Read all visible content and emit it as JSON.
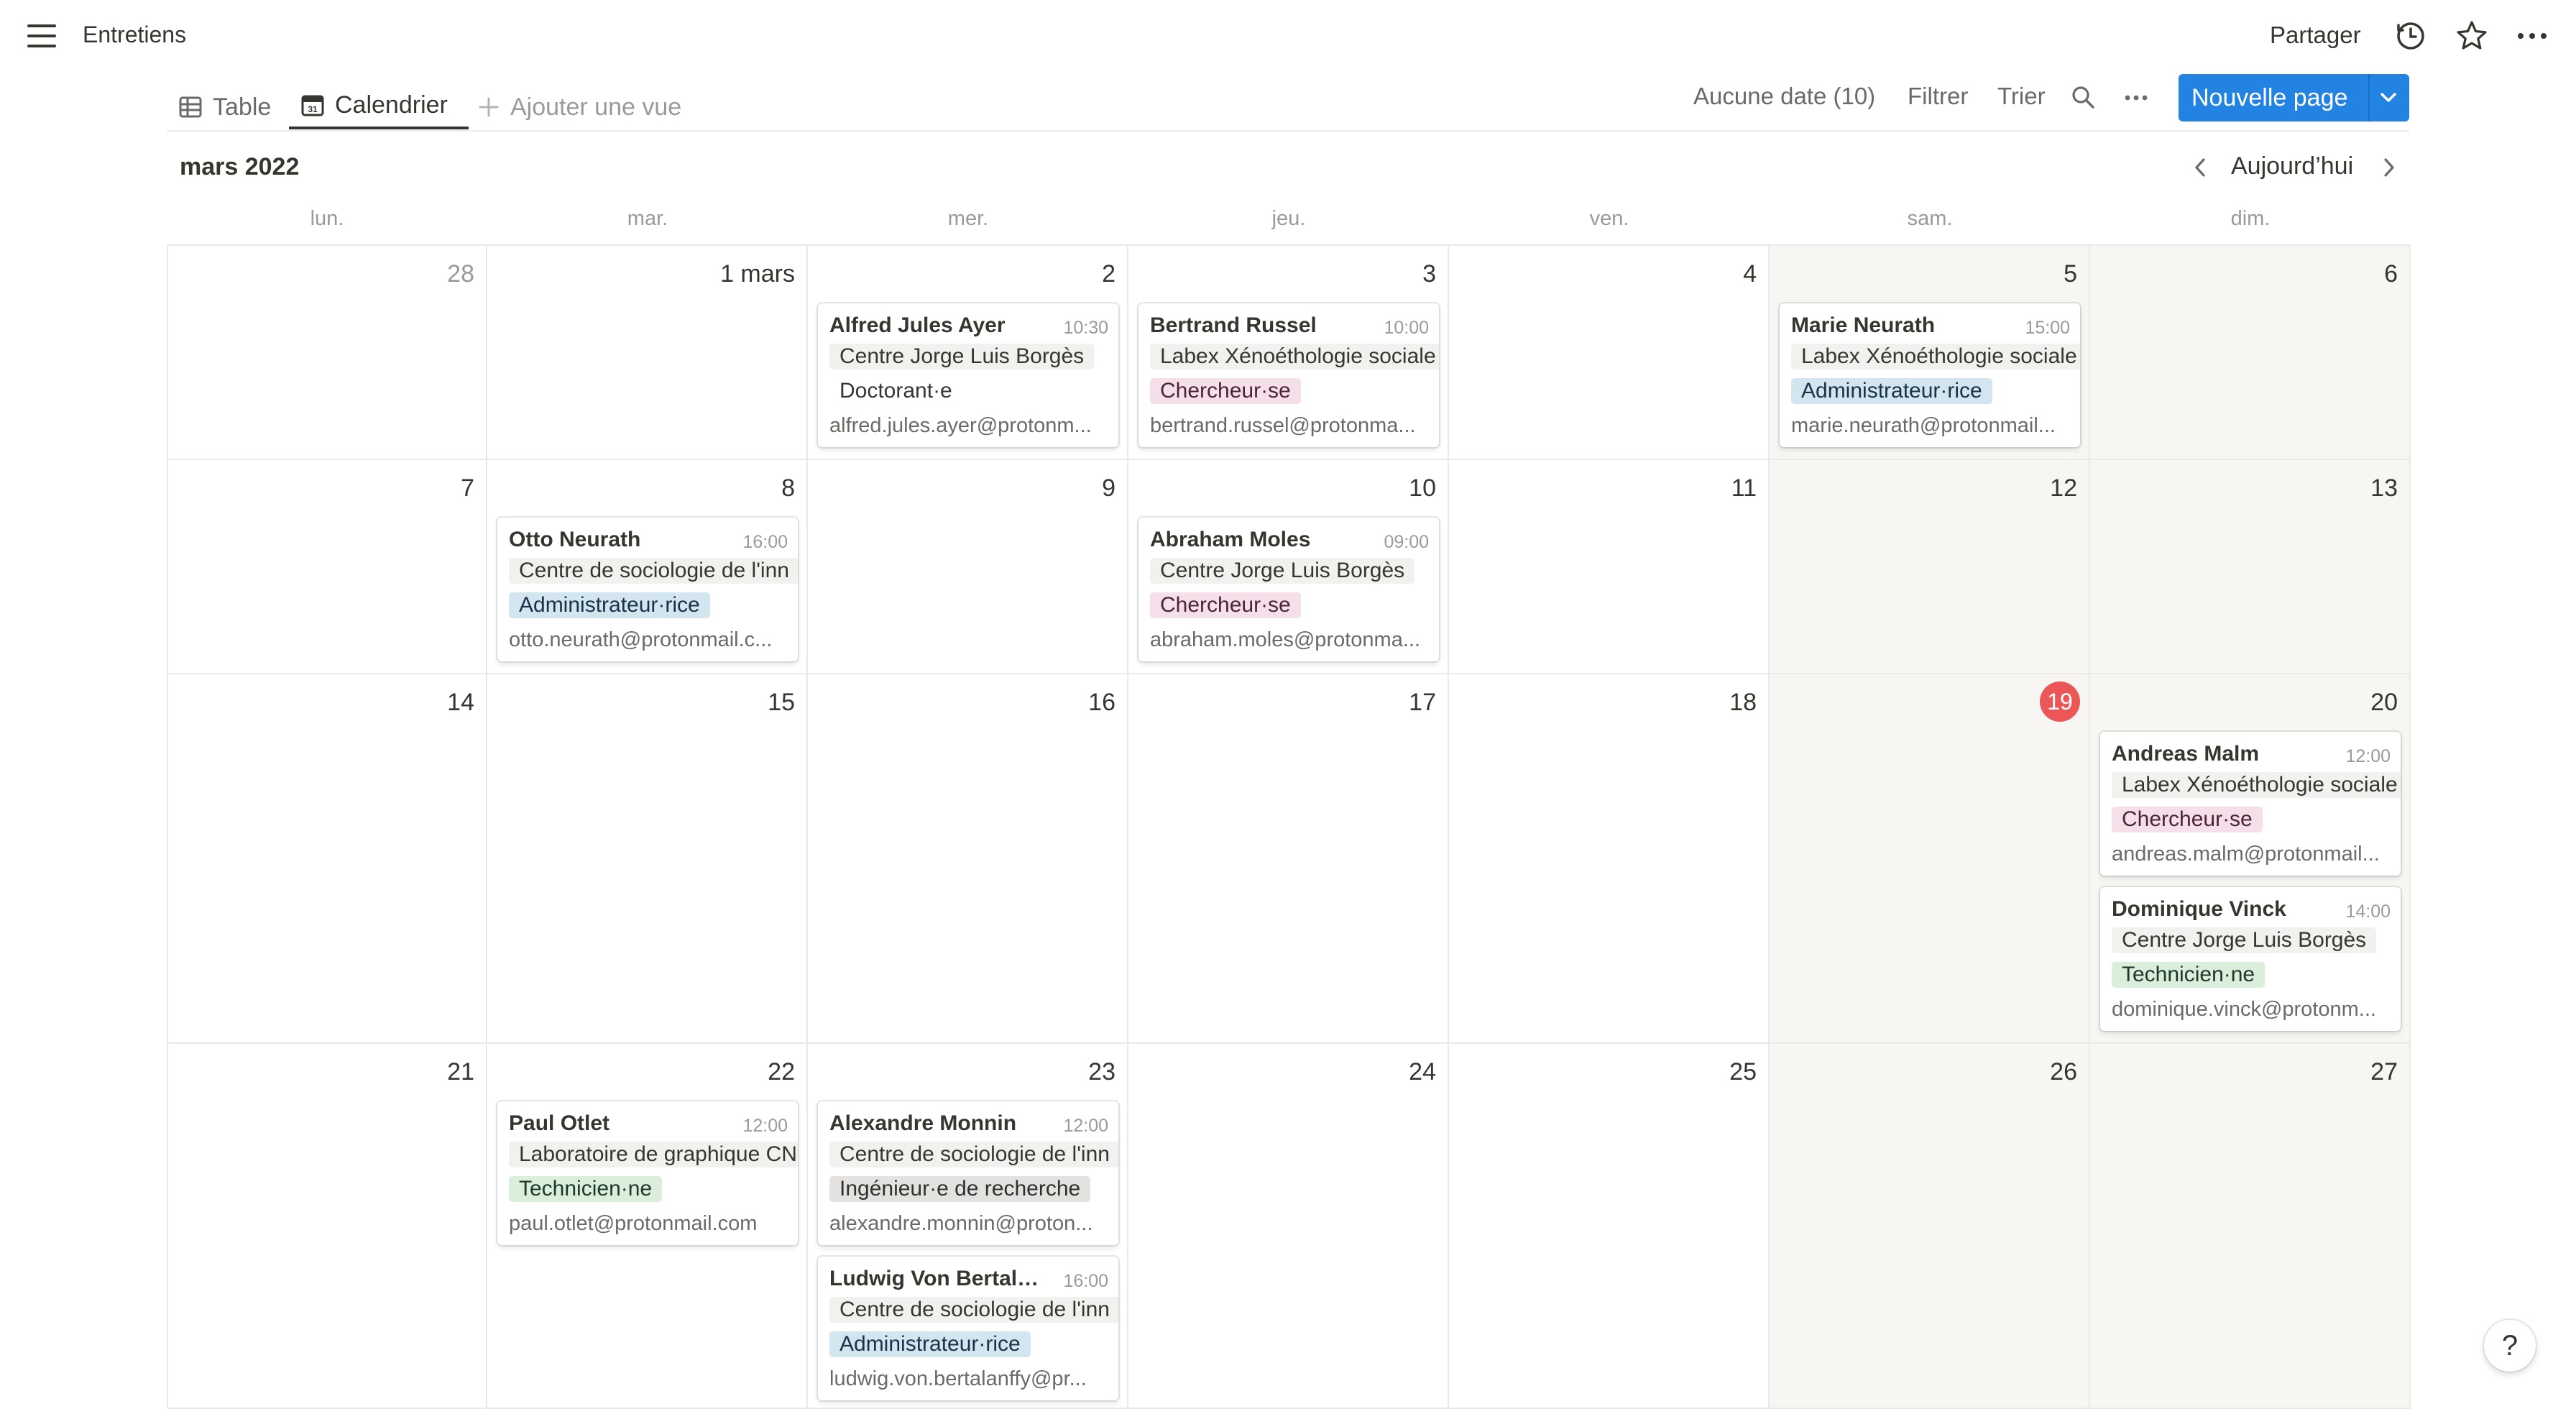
{
  "page_title": "Entretiens",
  "header": {
    "share_label": "Partager",
    "icons": [
      "menu-icon",
      "clock-icon",
      "star-icon",
      "more-icon"
    ]
  },
  "views": [
    {
      "label": "Table",
      "icon": "table-icon",
      "active": false
    },
    {
      "label": "Calendrier",
      "icon": "calendar-icon",
      "active": true
    }
  ],
  "add_view_label": "Ajouter une vue",
  "toolbar": {
    "no_date": "Aucune date (10)",
    "filter": "Filtrer",
    "sort": "Trier",
    "new_page": "Nouvelle page"
  },
  "calendar": {
    "month": "mars 2022",
    "today_label": "Aujourd’hui",
    "weekdays": [
      "lun.",
      "mar.",
      "mer.",
      "jeu.",
      "ven.",
      "sam.",
      "dim."
    ],
    "weeks": [
      [
        "28",
        "1 mars",
        "2",
        "3",
        "4",
        "5",
        "6"
      ],
      [
        "7",
        "8",
        "9",
        "10",
        "11",
        "12",
        "13"
      ],
      [
        "14",
        "15",
        "16",
        "17",
        "18",
        "19",
        "20"
      ],
      [
        "21",
        "22",
        "23",
        "24",
        "25",
        "26",
        "27"
      ]
    ],
    "today_day": "19"
  },
  "tag_colors": {
    "role_pink": {
      "bg": "#f5e0e9",
      "fg": "#4c2337"
    },
    "role_blue": {
      "bg": "#d3e5ef",
      "fg": "#183347"
    },
    "role_green": {
      "bg": "#dbeddb",
      "fg": "#1c3829"
    },
    "role_gray": {
      "bg": "#e3e2e0",
      "fg": "#32302c"
    }
  },
  "events": [
    {
      "week": 0,
      "day": 2,
      "slot": 0,
      "name": "Alfred Jules Ayer",
      "time": "10:30",
      "lab": "Centre Jorge Luis Borgès",
      "role": "Doctorant·e",
      "role_color": "none",
      "email": "alfred.jules.ayer@protonm..."
    },
    {
      "week": 0,
      "day": 3,
      "slot": 0,
      "name": "Bertrand Russel",
      "time": "10:00",
      "lab": "Labex Xénoéthologie sociale",
      "role": "Chercheur·se",
      "role_color": "role_pink",
      "email": "bertrand.russel@protonma..."
    },
    {
      "week": 0,
      "day": 5,
      "slot": 0,
      "name": "Marie Neurath",
      "time": "15:00",
      "lab": "Labex Xénoéthologie sociale",
      "role": "Administrateur·rice",
      "role_color": "role_blue",
      "email": "marie.neurath@protonmail..."
    },
    {
      "week": 1,
      "day": 1,
      "slot": 0,
      "name": "Otto Neurath",
      "time": "16:00",
      "lab": "Centre de sociologie de l'inn",
      "role": "Administrateur·rice",
      "role_color": "role_blue",
      "email": "otto.neurath@protonmail.c..."
    },
    {
      "week": 1,
      "day": 3,
      "slot": 0,
      "name": "Abraham Moles",
      "time": "09:00",
      "lab": "Centre Jorge Luis Borgès",
      "role": "Chercheur·se",
      "role_color": "role_pink",
      "email": "abraham.moles@protonma..."
    },
    {
      "week": 2,
      "day": 6,
      "slot": 0,
      "name": "Andreas Malm",
      "time": "12:00",
      "lab": "Labex Xénoéthologie sociale",
      "role": "Chercheur·se",
      "role_color": "role_pink",
      "email": "andreas.malm@protonmail..."
    },
    {
      "week": 2,
      "day": 6,
      "slot": 1,
      "name": "Dominique Vinck",
      "time": "14:00",
      "lab": "Centre Jorge Luis Borgès",
      "role": "Technicien·ne",
      "role_color": "role_green",
      "email": "dominique.vinck@protonm..."
    },
    {
      "week": 3,
      "day": 1,
      "slot": 0,
      "name": "Paul Otlet",
      "time": "12:00",
      "lab": "Laboratoire de graphique CN",
      "role": "Technicien·ne",
      "role_color": "role_green",
      "email": "paul.otlet@protonmail.com"
    },
    {
      "week": 3,
      "day": 2,
      "slot": 0,
      "name": "Alexandre Monnin",
      "time": "12:00",
      "lab": "Centre de sociologie de l'inn",
      "role": "Ingénieur·e de recherche",
      "role_color": "role_gray",
      "email": "alexandre.monnin@proton..."
    },
    {
      "week": 3,
      "day": 2,
      "slot": 1,
      "name": "Ludwig Von Bertala...",
      "time": "16:00",
      "lab": "Centre de sociologie de l'inn",
      "role": "Administrateur·rice",
      "role_color": "role_blue",
      "email": "ludwig.von.bertalanffy@pr..."
    }
  ],
  "help_label": "?"
}
